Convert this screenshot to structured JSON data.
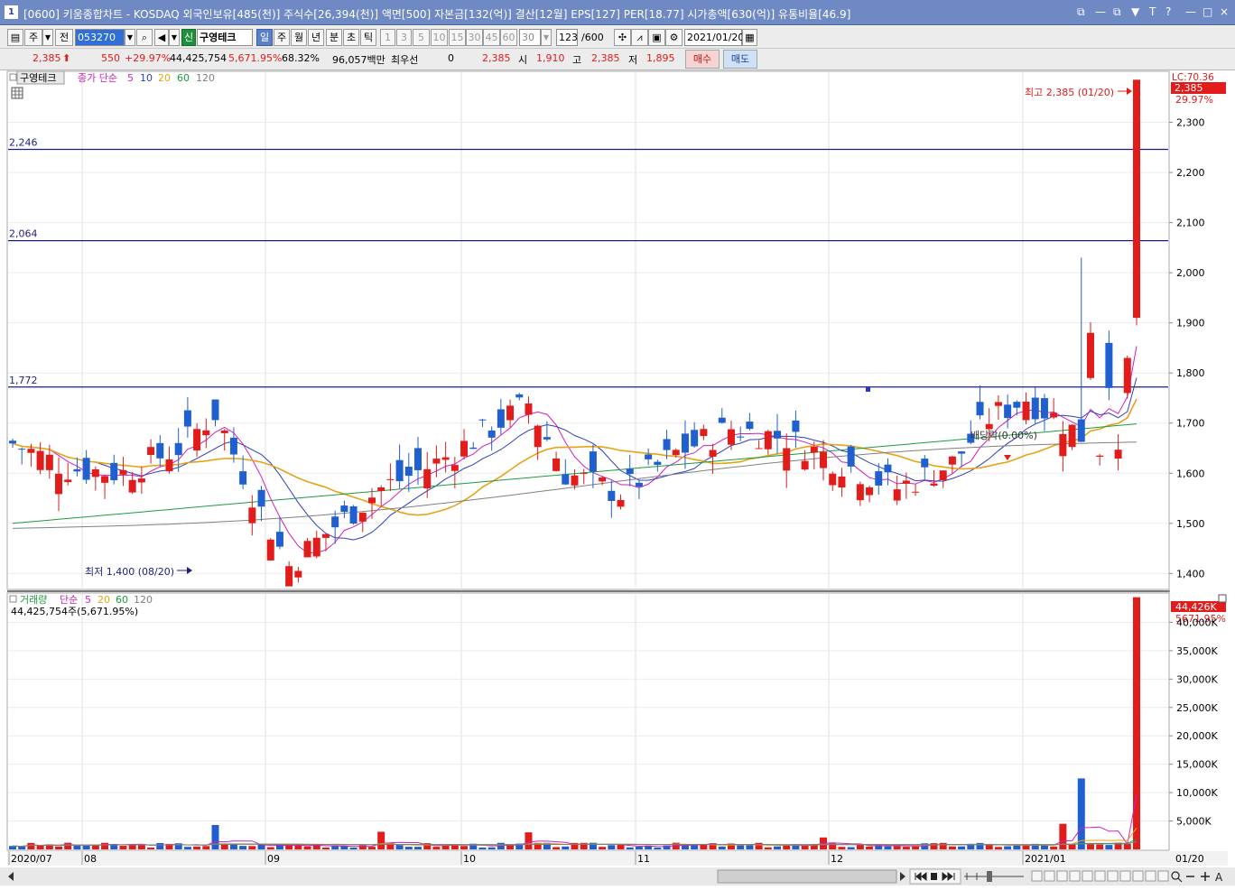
{
  "window": {
    "number": "1",
    "title": "[0600] 키움종합차트 - KOSDAQ 외국인보유[485(천)] 주식수[26,394(천)] 액면[500] 자본금[132(억)] 결산[12월] EPS[127] PER[18.77] 시가총액[630(억)] 유통비율[46.9]",
    "controls": [
      "⧉",
      "—",
      "⧉",
      "▼",
      "T",
      "?",
      "—",
      "□",
      "×"
    ]
  },
  "toolbar": {
    "mode_week": "주",
    "mode_all": "전",
    "stock_code": "053270",
    "badge_new": "신",
    "stock_name": "구영테크",
    "periods": [
      {
        "label": "일",
        "selected": true
      },
      {
        "label": "주",
        "selected": false
      },
      {
        "label": "월",
        "selected": false
      },
      {
        "label": "년",
        "selected": false
      },
      {
        "label": "분",
        "selected": false
      },
      {
        "label": "초",
        "selected": false
      },
      {
        "label": "틱",
        "selected": false
      }
    ],
    "intervals": [
      "1",
      "3",
      "5",
      "10",
      "15",
      "30",
      "45",
      "60"
    ],
    "interval_value": "30",
    "count_value": "123",
    "count_max": "/600",
    "date": "2021/01/20"
  },
  "quote": {
    "price": "2,385",
    "change": "550",
    "change_pct": "+29.97%",
    "volume": "44,425,754",
    "volume_pct": "5,671.95%",
    "turnover_pct": "68.32%",
    "amount": "96,057백만",
    "pref_label": "최우선",
    "pref_value": "0",
    "pref_price": "2,385",
    "open_label": "시",
    "open": "1,910",
    "high_label": "고",
    "high": "2,385",
    "low_label": "저",
    "low": "1,895",
    "buy_label": "매수",
    "sell_label": "매도"
  },
  "price_panel": {
    "stock_name": "구영테크",
    "legend_prefix": "종가 단순",
    "ma_labels": [
      "5",
      "10",
      "20",
      "60",
      "120"
    ],
    "ma_colors": [
      "#d01fbf",
      "#2b3fbf",
      "#e8a317",
      "#1e9a3c",
      "#808080"
    ],
    "lc_label": "LC:70.36",
    "current_badge": "2,385",
    "current_pct": "29.97%",
    "high_note": "최고 2,385 (01/20)",
    "low_note": "최저 1,400 (08/20)",
    "hlines": [
      "2,246",
      "2,064",
      "1,772"
    ],
    "yticks": [
      "2,300",
      "2,200",
      "2,100",
      "2,000",
      "1,900",
      "1,800",
      "1,700",
      "1,600",
      "1,500",
      "1,400"
    ],
    "dividend_note": "배당락(0.00%)"
  },
  "volume_panel": {
    "title": "거래량",
    "legend_prefix": "단순",
    "ma_labels": [
      "5",
      "20",
      "60",
      "120"
    ],
    "ma_colors": [
      "#d01fbf",
      "#e8a317",
      "#1e9a3c",
      "#808080"
    ],
    "info": "44,425,754주(5,671.95%)",
    "top_badge": "44,426K",
    "top_pct": "5671.95%",
    "yticks": [
      "40,000K",
      "35,000K",
      "30,000K",
      "25,000K",
      "20,000K",
      "15,000K",
      "10,000K",
      "5,000K"
    ]
  },
  "x_axis": {
    "labels": [
      "2020/07",
      "08",
      "09",
      "10",
      "11",
      "12",
      "2021/01"
    ],
    "last_date": "01/20"
  },
  "colors": {
    "up": "#e21b1b",
    "down": "#1f5fd0",
    "hline": "#1c1f7a",
    "title_bar": "#6e89c4"
  },
  "chart_data": {
    "type": "candlestick",
    "x_range": [
      "2020/07",
      "2021/01/20"
    ],
    "price_range": [
      1370,
      2400
    ],
    "horizontal_lines": [
      2246,
      2064,
      1772
    ],
    "high": {
      "value": 2385,
      "date": "01/20"
    },
    "low": {
      "value": 1400,
      "date": "08/20"
    },
    "last_candle": {
      "open": 1910,
      "high": 2385,
      "low": 1895,
      "close": 2385
    },
    "last_volume": 44425754,
    "volume_range": [
      0,
      45000000
    ]
  }
}
